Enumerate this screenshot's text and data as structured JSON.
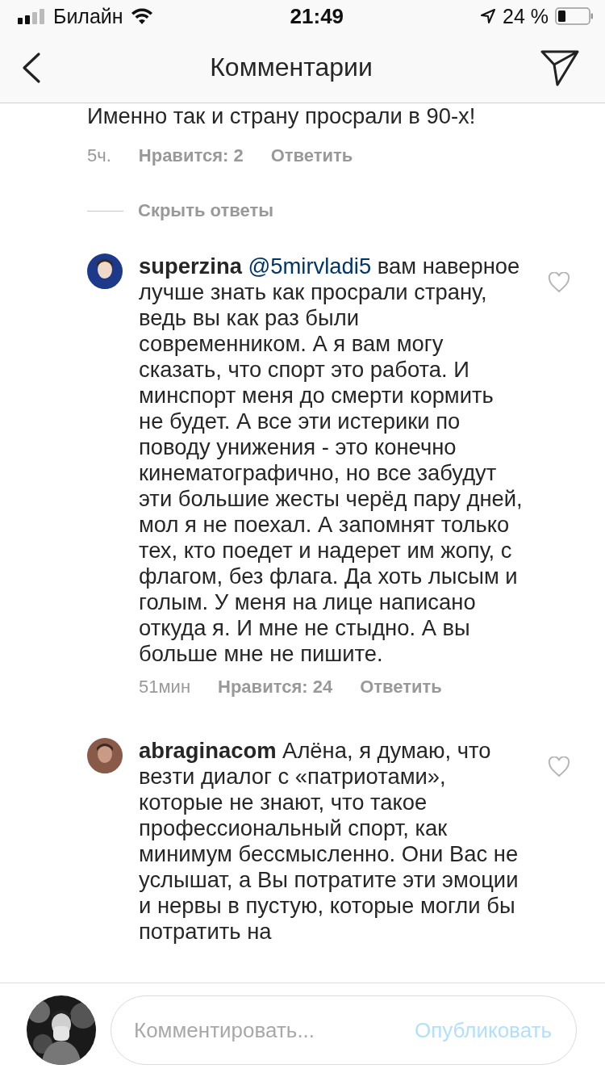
{
  "status_bar": {
    "carrier": "Билайн",
    "time": "21:49",
    "battery": "24 %"
  },
  "header": {
    "title": "Комментарии"
  },
  "comments": [
    {
      "kind": "partial",
      "text": "Именно так и страну просрали в 90-х!",
      "time": "5ч.",
      "likes": "Нравится: 2",
      "reply": "Ответить"
    },
    {
      "kind": "toggle",
      "text": "Скрыть ответы"
    },
    {
      "kind": "full",
      "username": "superzina",
      "mention": "@5mirvladi5",
      "text": " вам наверное лучше знать как просрали страну, ведь вы как раз были современником. А я вам могу сказать, что спорт это работа. И минспорт меня до смерти кормить не будет. А все эти истерики по поводу унижения - это конечно кинематографично, но все забудут эти большие жесты черёд пару дней, мол я не поехал. А запомнят только тех, кто поедет и надерет им жопу, с флагом, без флага. Да хоть лысым и голым. У меня на лице написано откуда я. И мне не стыдно. А вы больше мне не пишите.",
      "time": "51мин",
      "likes": "Нравится: 24",
      "reply": "Ответить",
      "liked": false
    },
    {
      "kind": "full",
      "username": "abraginacom",
      "text": " Алёна, я думаю, что везти диалог с «патриотами», которые не знают, что такое профессиональный спорт, как минимум бессмысленно. Они Вас не услышат, а Вы потратите эти эмоции и нервы в пустую, которые могли бы потратить на",
      "liked": false
    }
  ],
  "composer": {
    "placeholder": "Комментировать...",
    "button": "Опубликовать"
  }
}
